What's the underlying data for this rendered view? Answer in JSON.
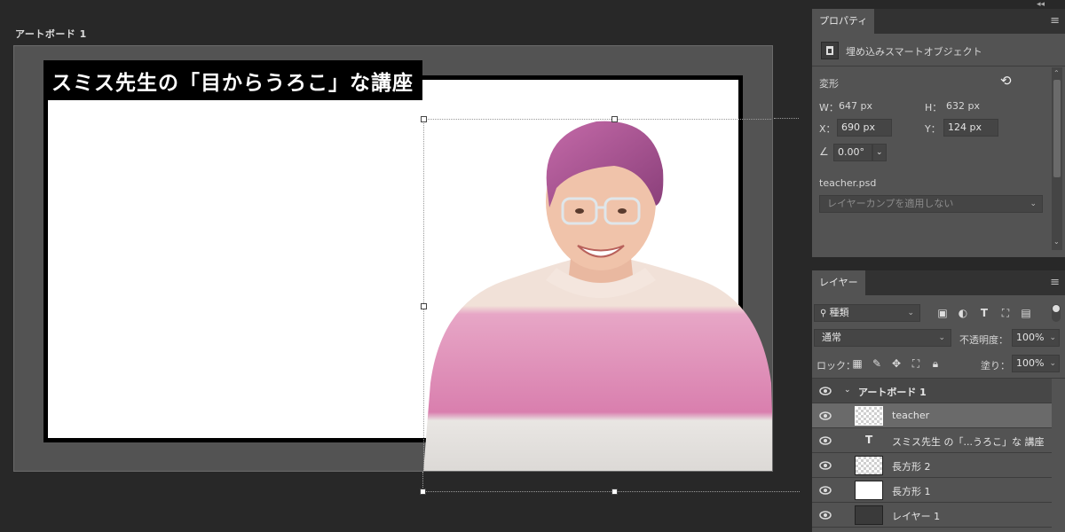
{
  "canvas": {
    "artboard_label": "アートボード 1",
    "title_text": "スミス先生の「目からうろこ」な講座"
  },
  "colors": {
    "workspace_bg": "#282828",
    "panel_bg": "#535353",
    "selected_layer": "#6a6a6a",
    "title_bg": "#000000",
    "title_fg": "#ffffff"
  },
  "properties": {
    "tab_label": "プロパティ",
    "object_type": "埋め込みスマートオブジェクト",
    "transform_label": "変形",
    "w_label": "W：",
    "w_value": "647 px",
    "h_label": "H：",
    "h_value": "632 px",
    "x_label": "X：",
    "x_value": "690 px",
    "y_label": "Y：",
    "y_value": "124 px",
    "angle_value": "0.00°",
    "file_name": "teacher.psd",
    "layer_comp": "レイヤーカンプを適用しない"
  },
  "layers": {
    "tab_label": "レイヤー",
    "filter_kind": "種類",
    "blend_mode": "通常",
    "opacity_label": "不透明度：",
    "opacity_value": "100%",
    "lock_label": "ロック：",
    "fill_label": "塗り：",
    "fill_value": "100%",
    "items": [
      {
        "name": "アートボード 1",
        "kind": "artboard",
        "selected": false
      },
      {
        "name": "teacher",
        "kind": "smart-object",
        "selected": true
      },
      {
        "name": "スミス先生 の「...うろこ」な 講座",
        "kind": "text",
        "selected": false
      },
      {
        "name": "長方形 2",
        "kind": "shape",
        "selected": false
      },
      {
        "name": "長方形 1",
        "kind": "shape",
        "selected": false
      },
      {
        "name": "レイヤー 1",
        "kind": "pixel",
        "selected": false
      }
    ]
  },
  "icons": {
    "collapse": "double-chevron-icon",
    "panel_menu": "hamburger-menu-icon",
    "reset": "reset-transform-icon",
    "visibility": "eye-icon"
  }
}
